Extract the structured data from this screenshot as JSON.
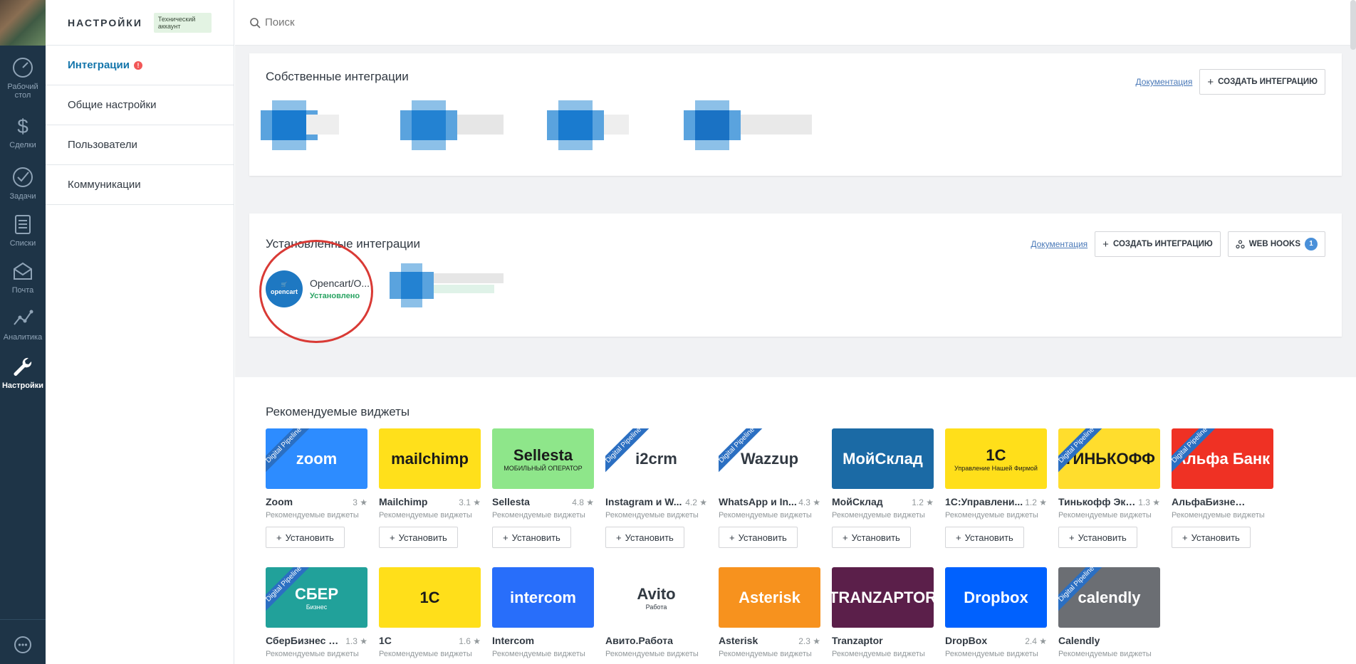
{
  "nav": {
    "items": [
      {
        "label": "Рабочий стол",
        "icon": "dashboard-icon"
      },
      {
        "label": "Сделки",
        "icon": "dollar-icon"
      },
      {
        "label": "Задачи",
        "icon": "check-icon"
      },
      {
        "label": "Списки",
        "icon": "list-icon"
      },
      {
        "label": "Почта",
        "icon": "mail-icon"
      },
      {
        "label": "Аналитика",
        "icon": "analytics-icon"
      },
      {
        "label": "Настройки",
        "icon": "wrench-icon"
      }
    ]
  },
  "settings": {
    "title": "НАСТРОЙКИ",
    "badge": "Технический аккаунт",
    "menu": [
      {
        "label": "Интеграции",
        "alert": "!"
      },
      {
        "label": "Общие настройки"
      },
      {
        "label": "Пользователи"
      },
      {
        "label": "Коммуникации"
      }
    ]
  },
  "search": {
    "placeholder": "Поиск"
  },
  "own": {
    "title": "Собственные интеграции",
    "doc": "Документация",
    "create": "СОЗДАТЬ ИНТЕГРАЦИЮ"
  },
  "installed": {
    "title": "Установленные интеграции",
    "doc": "Документация",
    "create": "СОЗДАТЬ ИНТЕГРАЦИЮ",
    "webhooks": "WEB HOOKS",
    "webhooks_count": "1",
    "opencart": {
      "name": "Opencart/O...",
      "status": "Установлено",
      "logo": "opencart"
    }
  },
  "recommended": {
    "title": "Рекомендуемые виджеты",
    "ribbon": "Digital Pipeline",
    "install": "Установить",
    "category": "Рекомендуемые виджеты",
    "items": [
      {
        "name": "Zoom",
        "rating": "3 ★",
        "logo": "zoom",
        "bg": "#2d8cff",
        "ribbon": true
      },
      {
        "name": "Mailchimp",
        "rating": "3.1 ★",
        "logo": "mailchimp",
        "bg": "#ffe01b",
        "ribbon": false
      },
      {
        "name": "Sellesta",
        "rating": "4.8 ★",
        "logo": "Sellesta",
        "sub": "МОБИЛЬНЫЙ ОПЕРАТОР",
        "bg": "#8ee68a",
        "ribbon": false
      },
      {
        "name": "Instagram и W...",
        "rating": "4.2 ★",
        "logo": "i2crm",
        "bg": "#ffffff",
        "ribbon": true
      },
      {
        "name": "WhatsApp и In...",
        "rating": "4.3 ★",
        "logo": "Wazzup",
        "bg": "#ffffff",
        "ribbon": true
      },
      {
        "name": "МойСклад",
        "rating": "1.2 ★",
        "logo": "МойСклад",
        "bg": "#1b6aa5",
        "ribbon": false
      },
      {
        "name": "1С:Управлени...",
        "rating": "1.2 ★",
        "logo": "1С",
        "sub": "Управление Нашей Фирмой",
        "bg": "#ffdf1a",
        "ribbon": false
      },
      {
        "name": "Тинькофф Экв...",
        "rating": "1.3 ★",
        "logo": "ТИНЬКОФФ",
        "bg": "#ffdd2d",
        "ribbon": true
      },
      {
        "name": "АльфаБизнес Эквай...",
        "rating": "",
        "logo": "Альфа Банк",
        "bg": "#ef3124",
        "ribbon": true
      },
      {
        "name": "СберБизнес Эк...",
        "rating": "1.3 ★",
        "logo": "СБЕР",
        "sub": "Бизнес",
        "bg": "#21a19a",
        "ribbon": true
      },
      {
        "name": "1С",
        "rating": "1.6 ★",
        "logo": "1С",
        "bg": "#ffdf1a",
        "ribbon": false
      },
      {
        "name": "Intercom",
        "rating": "",
        "logo": "intercom",
        "bg": "#286efa",
        "ribbon": false
      },
      {
        "name": "Авито.Работа",
        "rating": "",
        "logo": "Avito",
        "sub": "Работа",
        "bg": "#ffffff",
        "ribbon": false
      },
      {
        "name": "Asterisk",
        "rating": "2.3 ★",
        "logo": "Asterisk",
        "bg": "#f7921e",
        "ribbon": false
      },
      {
        "name": "Tranzaptor",
        "rating": "",
        "logo": "TRANZAPTOR",
        "bg": "#5b1f4a",
        "ribbon": false
      },
      {
        "name": "DropBox",
        "rating": "2.4 ★",
        "logo": "Dropbox",
        "bg": "#0061fe",
        "ribbon": false
      },
      {
        "name": "Calendly",
        "rating": "",
        "logo": "calendly",
        "bg": "#6b6e73",
        "ribbon": true
      }
    ]
  }
}
